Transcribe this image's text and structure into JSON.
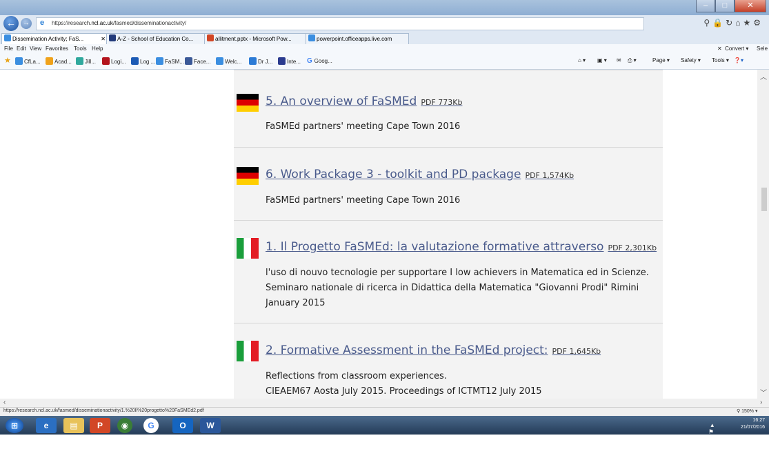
{
  "browser": {
    "url_prefix": "https://research.",
    "url_domain": "ncl.ac.uk",
    "url_path": "/fasmed/disseminationactivity/",
    "tabs": [
      {
        "label": "Dissemination Activity; FaS...",
        "icon": "ie-icon",
        "active": true
      },
      {
        "label": "A-Z - School of Education Co...",
        "icon": "ncl-icon",
        "active": false
      },
      {
        "label": "allitment.pptx - Microsoft Pow...",
        "icon": "powerpoint-icon",
        "active": false
      },
      {
        "label": "powerpoint.officeapps.live.com",
        "icon": "ie-icon",
        "active": false
      }
    ],
    "menu": [
      "File",
      "Edit",
      "View",
      "Favorites",
      "Tools",
      "Help"
    ],
    "convert_label": "Convert",
    "select_label": "Sele",
    "favorites": [
      "CfLa...",
      "Acad...",
      "Jill...",
      "Logi...",
      "Log ...",
      "FaSM...",
      "Face...",
      "Welc...",
      "Dr J...",
      "Inte...",
      "Goog..."
    ],
    "command_bar": {
      "page": "Page",
      "safety": "Safety",
      "tools": "Tools"
    }
  },
  "documents": [
    {
      "flag": "de",
      "title": "5. An overview of FaSMEd",
      "pdf": "PDF 773Kb",
      "description": [
        "FaSMEd partners' meeting Cape Town 2016"
      ]
    },
    {
      "flag": "de",
      "title": "6. Work Package 3 - toolkit and PD package",
      "pdf": "PDF 1,574Kb",
      "description": [
        "FaSMEd partners' meeting Cape Town 2016"
      ]
    },
    {
      "flag": "it",
      "title": "1. Il Progetto FaSMEd: la valutazione formative attraverso",
      "pdf": "PDF 2,301Kb",
      "description": [
        "l'uso di nouvo tecnologie per supportare I low achievers in Matematica ed in Scienze.",
        "Seminaro nationale di ricerca in Didattica della Matematica \"Giovanni Prodi\" Rimini",
        "January 2015"
      ]
    },
    {
      "flag": "it",
      "title": "2. Formative Assessment in the FaSMEd project:",
      "pdf": "PDF 1,645Kb",
      "description": [
        "Reflections from classroom experiences.",
        "CIEAEM67 Aosta July 2015. Proceedings of ICTMT12 July 2015"
      ]
    }
  ],
  "status_url": "https://research.ncl.ac.uk/fasmed/disseminationactivity/1.%20Il%20progetto%20FaSMEd2.pdf",
  "zoom": "150%",
  "clock": {
    "time": "16:27",
    "date": "21/07/2016"
  }
}
